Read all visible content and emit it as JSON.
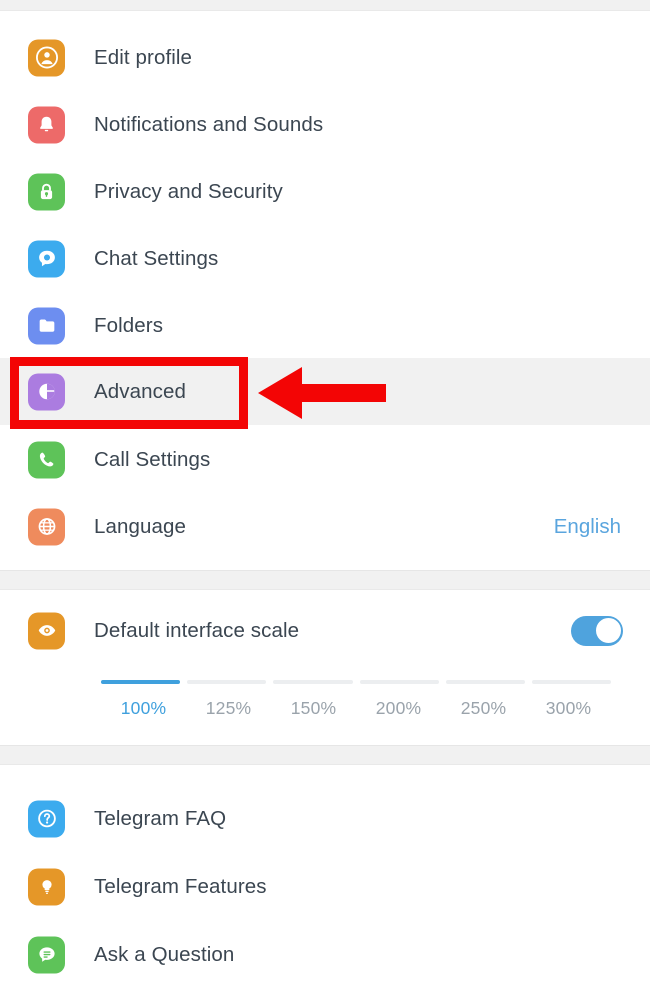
{
  "colors": {
    "band": "#f1f1f1",
    "row_highlight": "#f1f1f1",
    "text": "#3b4651",
    "accent_blue": "#5aa5de",
    "annotation_red": "#f30505",
    "toggle_on": "#4fa3dd",
    "scale_inactive": "#9aa3ab"
  },
  "settings_sections": [
    {
      "name": "main-settings",
      "items": [
        {
          "label": "Edit profile",
          "icon": "user-avatar-icon",
          "icon_color": "#e59728",
          "value": ""
        },
        {
          "label": "Notifications and Sounds",
          "icon": "bell-icon",
          "icon_color": "#ed6a69",
          "value": ""
        },
        {
          "label": "Privacy and Security",
          "icon": "lock-icon",
          "icon_color": "#5ec359",
          "value": ""
        },
        {
          "label": "Chat Settings",
          "icon": "chat-bubble-icon",
          "icon_color": "#3cabee",
          "value": ""
        },
        {
          "label": "Folders",
          "icon": "folder-icon",
          "icon_color": "#6d8ef0",
          "value": ""
        },
        {
          "label": "Advanced",
          "icon": "contrast-icon",
          "icon_color": "#ab7ce0",
          "value": ""
        },
        {
          "label": "Call Settings",
          "icon": "phone-icon",
          "icon_color": "#5ec359",
          "value": ""
        },
        {
          "label": "Language",
          "icon": "globe-icon",
          "icon_color": "#ef8b5d",
          "value": "English"
        }
      ]
    },
    {
      "name": "interface-scale",
      "items": [
        {
          "label": "Default interface scale",
          "icon": "eye-icon",
          "icon_color": "#e59728",
          "value": ""
        }
      ]
    },
    {
      "name": "help-links",
      "items": [
        {
          "label": "Telegram FAQ",
          "icon": "question-mark-icon",
          "icon_color": "#3cabee",
          "value": ""
        },
        {
          "label": "Telegram Features",
          "icon": "lightbulb-icon",
          "icon_color": "#e59728",
          "value": ""
        },
        {
          "label": "Ask a Question",
          "icon": "message-lines-icon",
          "icon_color": "#5ec359",
          "value": ""
        }
      ]
    }
  ],
  "interface_scale": {
    "toggle_label": "Default interface scale",
    "toggle_on": true,
    "selected": "100%",
    "options": [
      "100%",
      "125%",
      "150%",
      "200%",
      "250%",
      "300%"
    ]
  },
  "annotations": {
    "highlight_target": "Advanced",
    "box_color": "#f30505",
    "arrow_color": "#f30505",
    "arrow_direction": "left"
  }
}
